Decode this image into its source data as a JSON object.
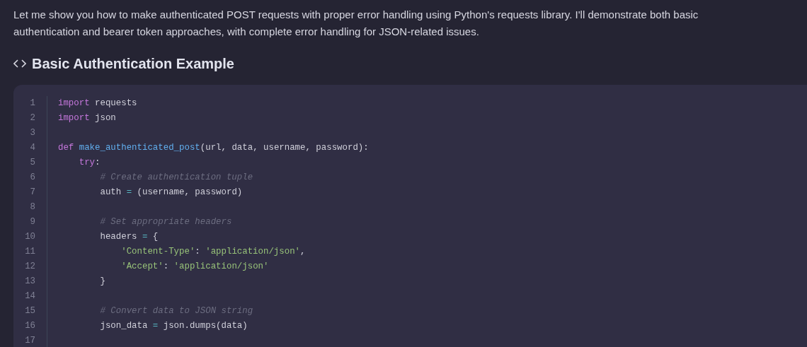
{
  "intro": "Let me show you how to make authenticated POST requests with proper error handling using Python's requests library. I'll demonstrate both basic authentication and bearer token approaches, with complete error handling for JSON-related issues.",
  "section": {
    "title": "Basic Authentication Example"
  },
  "code": {
    "lines": [
      {
        "number": "1",
        "tokens": [
          {
            "kind": "keyword",
            "text": "import"
          },
          {
            "kind": "plain",
            "text": " requests"
          }
        ]
      },
      {
        "number": "2",
        "tokens": [
          {
            "kind": "keyword",
            "text": "import"
          },
          {
            "kind": "plain",
            "text": " json"
          }
        ]
      },
      {
        "number": "3"
      },
      {
        "number": "4",
        "tokens": [
          {
            "kind": "keyword",
            "text": "def "
          },
          {
            "kind": "function",
            "text": "make_authenticated_post"
          },
          {
            "kind": "plain",
            "text": "(url, data, username, password):"
          }
        ]
      },
      {
        "number": "5",
        "tokens": [
          {
            "kind": "keyword",
            "text": "    try"
          },
          {
            "kind": "plain",
            "text": ":"
          }
        ]
      },
      {
        "number": "6",
        "tokens": [
          {
            "kind": "comment",
            "text": "        # Create authentication tuple"
          }
        ]
      },
      {
        "number": "7",
        "tokens": [
          {
            "kind": "plain",
            "text": "        auth "
          },
          {
            "kind": "operator",
            "text": "="
          },
          {
            "kind": "plain",
            "text": " (username, password)"
          }
        ]
      },
      {
        "number": "8"
      },
      {
        "number": "9",
        "tokens": [
          {
            "kind": "comment",
            "text": "        # Set appropriate headers"
          }
        ]
      },
      {
        "number": "10",
        "tokens": [
          {
            "kind": "plain",
            "text": "        headers "
          },
          {
            "kind": "operator",
            "text": "="
          },
          {
            "kind": "plain",
            "text": " {"
          }
        ]
      },
      {
        "number": "11",
        "tokens": [
          {
            "kind": "string",
            "text": "            'Content-Type'"
          },
          {
            "kind": "plain",
            "text": ": "
          },
          {
            "kind": "string",
            "text": "'application/json'"
          },
          {
            "kind": "plain",
            "text": ","
          }
        ]
      },
      {
        "number": "12",
        "tokens": [
          {
            "kind": "string",
            "text": "            'Accept'"
          },
          {
            "kind": "plain",
            "text": ": "
          },
          {
            "kind": "string",
            "text": "'application/json'"
          }
        ]
      },
      {
        "number": "13",
        "tokens": [
          {
            "kind": "plain",
            "text": "        }"
          }
        ]
      },
      {
        "number": "14"
      },
      {
        "number": "15",
        "tokens": [
          {
            "kind": "comment",
            "text": "        # Convert data to JSON string"
          }
        ]
      },
      {
        "number": "16",
        "tokens": [
          {
            "kind": "plain",
            "text": "        json_data "
          },
          {
            "kind": "operator",
            "text": "="
          },
          {
            "kind": "plain",
            "text": " json.dumps(data)"
          }
        ]
      },
      {
        "number": "17"
      }
    ]
  }
}
